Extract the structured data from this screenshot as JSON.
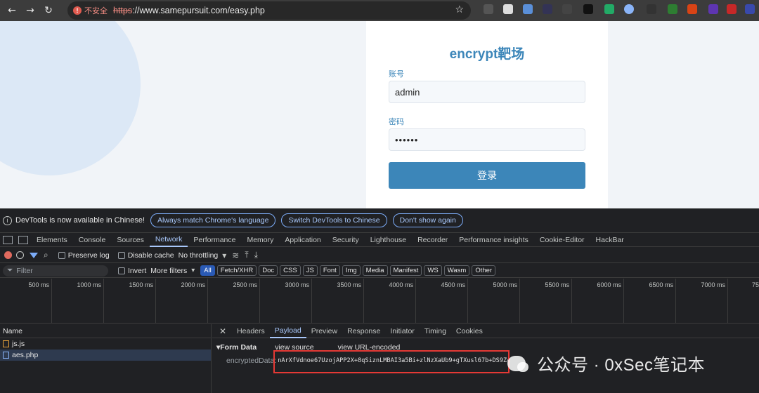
{
  "browser": {
    "security_label": "不安全",
    "url_https": "https",
    "url_rest": "://www.samepursuit.com/easy.php"
  },
  "login": {
    "title": "encrypt靶场",
    "username_label": "账号",
    "username_value": "admin",
    "password_label": "密码",
    "password_value": "••••••",
    "submit_label": "登录"
  },
  "devtools": {
    "notice": {
      "text": "DevTools is now available in Chinese!",
      "btn_match": "Always match Chrome's language",
      "btn_switch": "Switch DevTools to Chinese",
      "btn_dont_show": "Don't show again"
    },
    "tabs": [
      "Elements",
      "Console",
      "Sources",
      "Network",
      "Performance",
      "Memory",
      "Application",
      "Security",
      "Lighthouse",
      "Recorder",
      "Performance insights",
      "Cookie-Editor",
      "HackBar"
    ],
    "toolbar": {
      "preserve_log": "Preserve log",
      "disable_cache": "Disable cache",
      "throttling": "No throttling"
    },
    "filter": {
      "placeholder": "Filter",
      "invert": "Invert",
      "more_filters": "More filters",
      "chips": [
        "All",
        "Fetch/XHR",
        "Doc",
        "CSS",
        "JS",
        "Font",
        "Img",
        "Media",
        "Manifest",
        "WS",
        "Wasm",
        "Other"
      ]
    },
    "timeline_ticks": [
      "500 ms",
      "1000 ms",
      "1500 ms",
      "2000 ms",
      "2500 ms",
      "3000 ms",
      "3500 ms",
      "4000 ms",
      "4500 ms",
      "5000 ms",
      "5500 ms",
      "6000 ms",
      "6500 ms",
      "7000 ms",
      "75"
    ],
    "requests": {
      "name_header": "Name",
      "items": [
        "js.js",
        "aes.php"
      ]
    },
    "detail_tabs": [
      "Headers",
      "Payload",
      "Preview",
      "Response",
      "Initiator",
      "Timing",
      "Cookies"
    ],
    "payload": {
      "section": "▾Form Data",
      "view_source": "view source",
      "view_url_encoded": "view URL-encoded",
      "key": "encryptedData:",
      "value": "nArXfVdnoe67UzojAPP2X+8qSiznLMBAI3a5Bi+zlNzXaUb9+gTXusl67b+DS9Z4"
    }
  },
  "watermark": {
    "text": "公众号 · 0xSec笔记本"
  },
  "colors": {
    "accent": "#3c86b9",
    "devtools_bg": "#202124",
    "highlight": "#e53935"
  }
}
